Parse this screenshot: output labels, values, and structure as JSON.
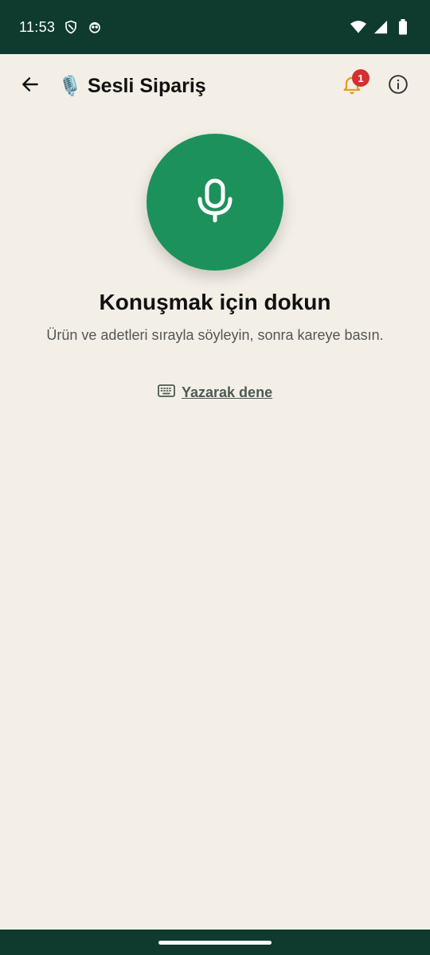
{
  "status_bar": {
    "time": "11:53",
    "left_icons": [
      "shield-icon",
      "cat-face-icon"
    ],
    "right_icons": [
      "wifi-icon",
      "signal-icon",
      "battery-icon"
    ]
  },
  "app_bar": {
    "title_emoji": "🎙️",
    "title": "Sesli Sipariş",
    "notification_count": "1",
    "icons": [
      "back-arrow-icon",
      "bell-icon",
      "info-icon"
    ]
  },
  "main": {
    "headline": "Konuşmak için dokun",
    "subtext": "Ürün ve adetleri sırayla söyleyin, sonra kareye basın.",
    "type_link": "Yazarak dene"
  },
  "colors": {
    "status_bar": "#0e3b2e",
    "background": "#f3efe7",
    "mic_button": "#1c915b",
    "bell": "#e0a21b",
    "badge": "#d32f2f"
  }
}
